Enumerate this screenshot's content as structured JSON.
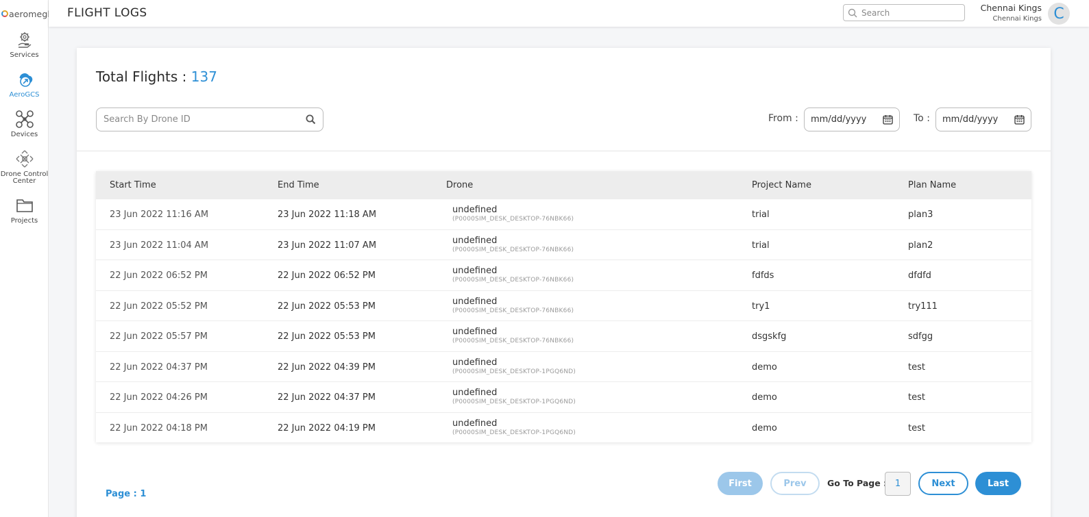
{
  "app": {
    "logo_text": "aeromegh",
    "page_title": "FLIGHT LOGS"
  },
  "sidebar": {
    "items": [
      {
        "label": "Services",
        "icon": "gear-hand-icon"
      },
      {
        "label": "AeroGCS",
        "icon": "aerogcs-icon",
        "active": true
      },
      {
        "label": "Devices",
        "icon": "drone-icon"
      },
      {
        "label": "Drone Control Center",
        "icon": "drone-control-icon"
      },
      {
        "label": "Projects",
        "icon": "folder-icon"
      }
    ]
  },
  "header": {
    "search_placeholder": "Search",
    "user_name": "Chennai Kings",
    "user_org": "Chennai Kings",
    "avatar_initial": "C"
  },
  "summary": {
    "total_label": "Total Flights :",
    "total_count": "137"
  },
  "filters": {
    "drone_search_placeholder": "Search By Drone ID",
    "from_label": "From :",
    "to_label": "To :",
    "date_placeholder": "mm/dd/yyyy"
  },
  "table": {
    "columns": [
      "Start Time",
      "End Time",
      "Drone",
      "Project Name",
      "Plan Name"
    ],
    "rows": [
      {
        "start": "23 Jun 2022 11:16 AM",
        "end": "23 Jun 2022 11:18 AM",
        "drone_name": "undefined",
        "drone_id": "(P0000SIM_DESK_DESKTOP-76NBK66)",
        "project": "trial",
        "plan": "plan3"
      },
      {
        "start": "23 Jun 2022 11:04 AM",
        "end": "23 Jun 2022 11:07 AM",
        "drone_name": "undefined",
        "drone_id": "(P0000SIM_DESK_DESKTOP-76NBK66)",
        "project": "trial",
        "plan": "plan2"
      },
      {
        "start": "22 Jun 2022 06:52 PM",
        "end": "22 Jun 2022 06:52 PM",
        "drone_name": "undefined",
        "drone_id": "(P0000SIM_DESK_DESKTOP-76NBK66)",
        "project": "fdfds",
        "plan": "dfdfd"
      },
      {
        "start": "22 Jun 2022 05:52 PM",
        "end": "22 Jun 2022 05:53 PM",
        "drone_name": "undefined",
        "drone_id": "(P0000SIM_DESK_DESKTOP-76NBK66)",
        "project": "try1",
        "plan": "try111"
      },
      {
        "start": "22 Jun 2022 05:57 PM",
        "end": "22 Jun 2022 05:53 PM",
        "drone_name": "undefined",
        "drone_id": "(P0000SIM_DESK_DESKTOP-76NBK66)",
        "project": "dsgskfg",
        "plan": "sdfgg"
      },
      {
        "start": "22 Jun 2022 04:37 PM",
        "end": "22 Jun 2022 04:39 PM",
        "drone_name": "undefined",
        "drone_id": "(P0000SIM_DESK_DESKTOP-1PGQ6ND)",
        "project": "demo",
        "plan": "test"
      },
      {
        "start": "22 Jun 2022 04:26 PM",
        "end": "22 Jun 2022 04:37 PM",
        "drone_name": "undefined",
        "drone_id": "(P0000SIM_DESK_DESKTOP-1PGQ6ND)",
        "project": "demo",
        "plan": "test"
      },
      {
        "start": "22 Jun 2022 04:18 PM",
        "end": "22 Jun 2022 04:19 PM",
        "drone_name": "undefined",
        "drone_id": "(P0000SIM_DESK_DESKTOP-1PGQ6ND)",
        "project": "demo",
        "plan": "test"
      }
    ]
  },
  "pagination": {
    "page_label": "Page : 1",
    "first": "First",
    "prev": "Prev",
    "goto_label": "Go To Page :",
    "goto_value": "1",
    "next": "Next",
    "last": "Last"
  },
  "colors": {
    "accent": "#2d8fd5",
    "accent_light": "#9cc7ea"
  }
}
